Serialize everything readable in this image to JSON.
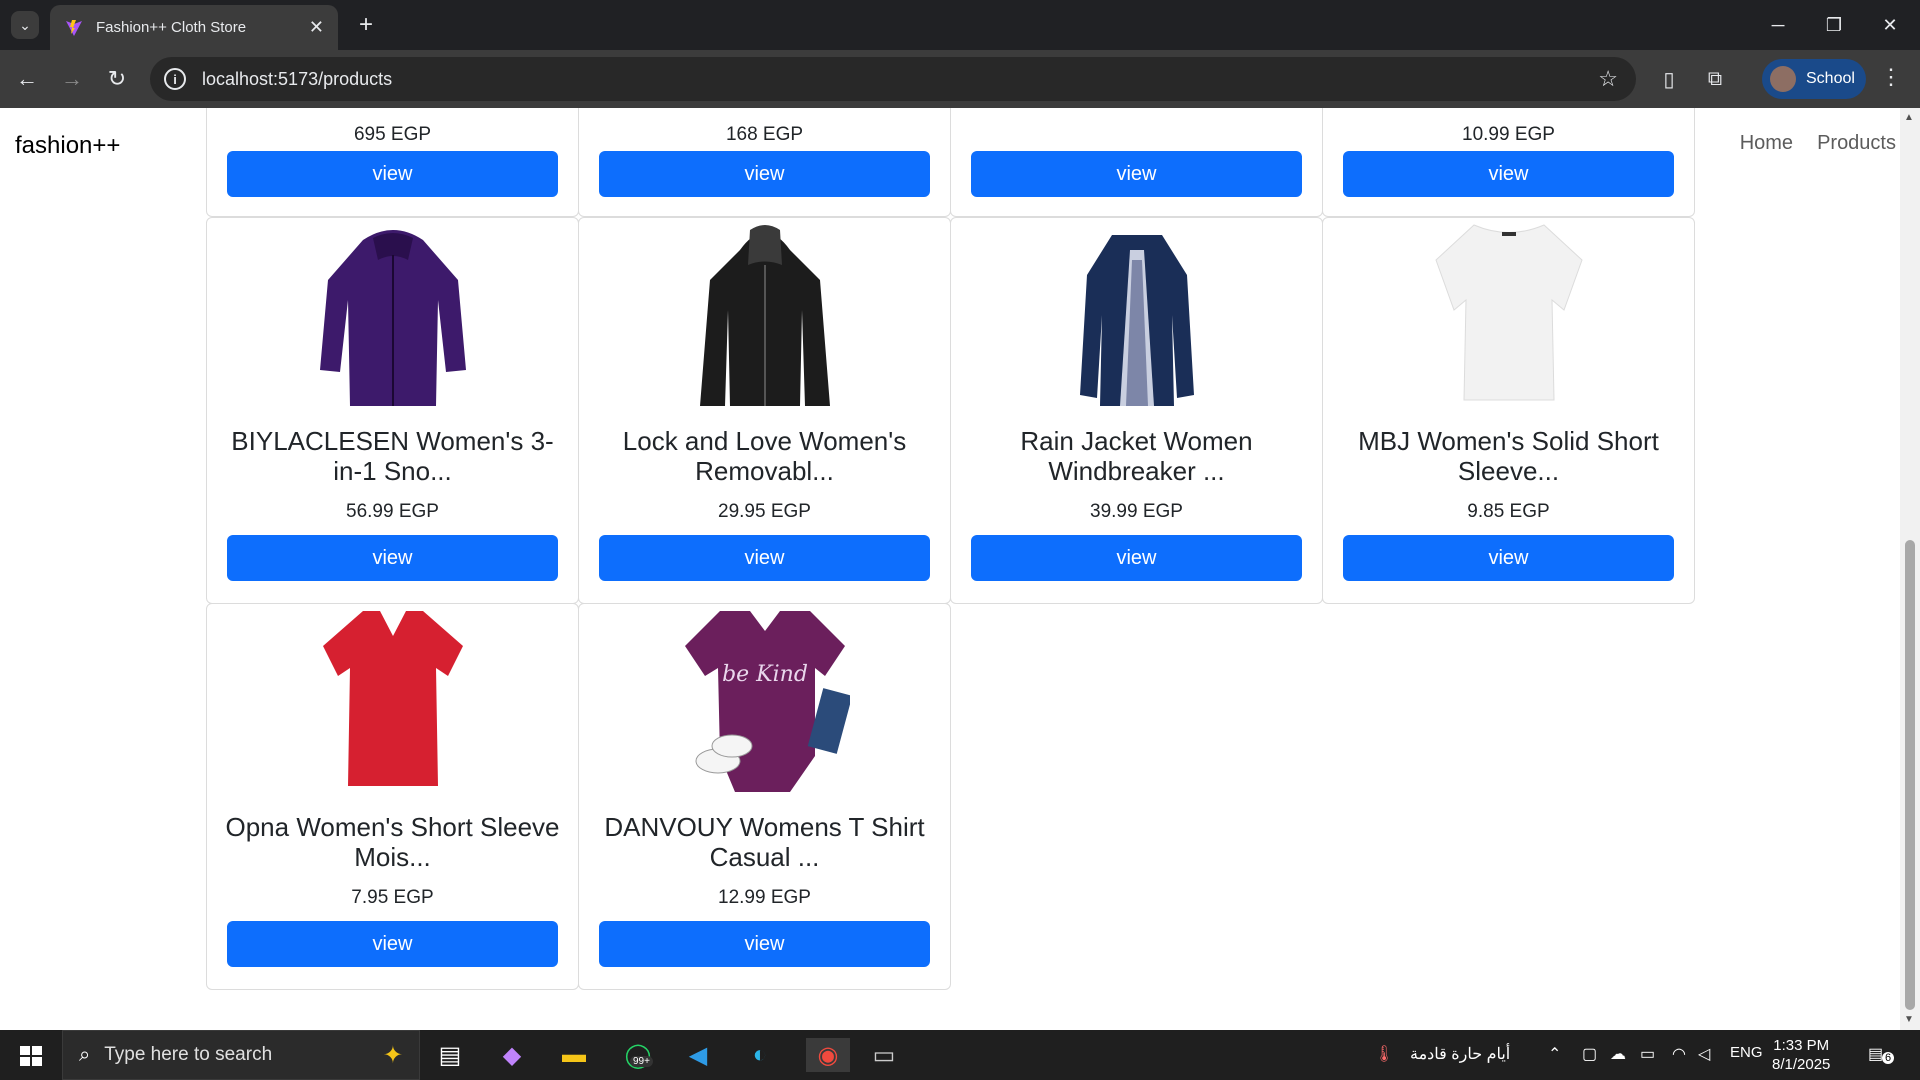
{
  "browser": {
    "tab_title": "Fashion++ Cloth Store",
    "url": "localhost:5173/products",
    "profile_name": "School"
  },
  "site": {
    "brand": "fashion++",
    "nav": [
      "Home",
      "Products"
    ]
  },
  "products_top_row": [
    {
      "price": "695 EGP",
      "button": "view"
    },
    {
      "price": "168 EGP",
      "button": "view"
    },
    {
      "price": "",
      "button": "view"
    },
    {
      "price": "10.99 EGP",
      "button": "view"
    }
  ],
  "products": [
    {
      "name": "BIYLACLESEN Women's 3-in-1 Sno...",
      "price": "56.99 EGP",
      "button": "view",
      "image": "purple-jacket",
      "color": "#3d1a6b"
    },
    {
      "name": "Lock and Love Women's Removabl...",
      "price": "29.95 EGP",
      "button": "view",
      "image": "black-leather-jacket",
      "color": "#1c1c1c"
    },
    {
      "name": "Rain Jacket Women Windbreaker ...",
      "price": "39.99 EGP",
      "button": "view",
      "image": "navy-raincoat",
      "color": "#1a2e57"
    },
    {
      "name": "MBJ Women's Solid Short Sleeve...",
      "price": "9.85 EGP",
      "button": "view",
      "image": "white-tshirt",
      "color": "#f2f2f2"
    },
    {
      "name": "Opna Women's Short Sleeve Mois...",
      "price": "7.95 EGP",
      "button": "view",
      "image": "red-tshirt",
      "color": "#d62030"
    },
    {
      "name": "DANVOUY Womens T Shirt Casual ...",
      "price": "12.99 EGP",
      "button": "view",
      "image": "purple-be-kind-tshirt",
      "color": "#6b1f5c",
      "print": "be Kind"
    }
  ],
  "taskbar": {
    "search_placeholder": "Type here to search",
    "weather_text": "أيام حارة قادمة",
    "lang": "ENG",
    "time": "1:33 PM",
    "date": "8/1/2025",
    "whatsapp_badge": "99+",
    "notifications": "6"
  },
  "colors": {
    "primary_button": "#0d6efd",
    "chrome_dark": "#202124",
    "chrome_toolbar": "#3c3c3c"
  }
}
